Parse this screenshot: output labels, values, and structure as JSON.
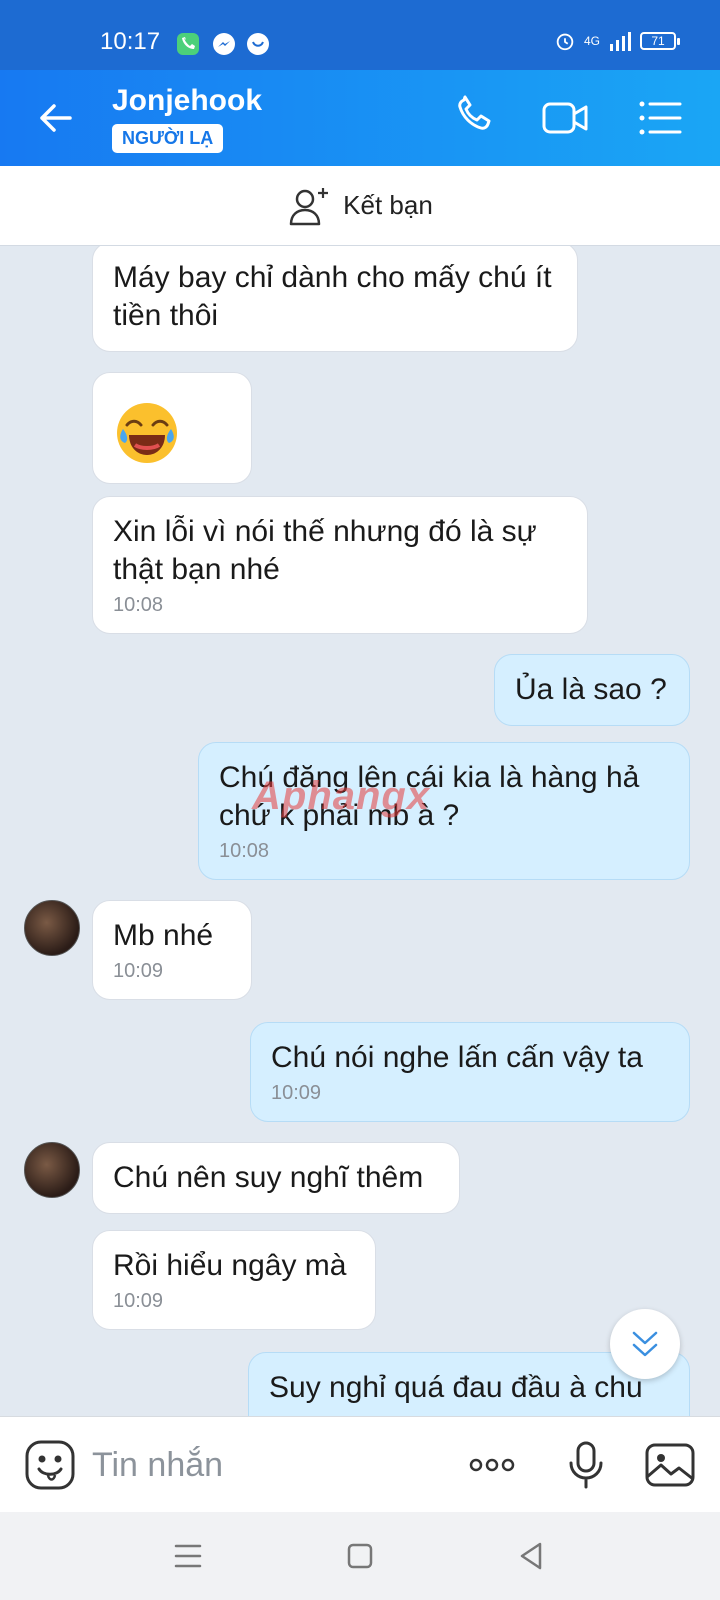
{
  "status_bar": {
    "time": "10:17",
    "network": "4G",
    "battery": "71",
    "left_icons": [
      "phone-icon",
      "messenger-icon",
      "heart-app-icon"
    ],
    "right_icons": [
      "alarm-icon",
      "signal-icon",
      "battery-icon"
    ]
  },
  "header": {
    "contact_name": "Jonjehook",
    "badge": "NGƯỜI LẠ",
    "icons": [
      "back-arrow-icon",
      "phone-call-icon",
      "video-call-icon",
      "menu-list-icon"
    ]
  },
  "add_friend": {
    "label": "Kết bạn",
    "icon": "add-person-icon"
  },
  "messages": [
    {
      "dir": "in",
      "text": "Máy bay chỉ dành cho mấy chú ít tiền thôi"
    },
    {
      "dir": "in",
      "emoji": "tears-of-joy-icon"
    },
    {
      "dir": "in",
      "text": "Xin lỗi vì nói thế nhưng đó là sự thật bạn nhé",
      "time": "10:08"
    },
    {
      "dir": "out",
      "text": "Ủa là sao ?"
    },
    {
      "dir": "out",
      "text": "Chú đăng lên cái kia là hàng hả chứ k phải mb à ?",
      "time": "10:08"
    },
    {
      "dir": "in",
      "text": "Mb nhé",
      "time": "10:09",
      "avatar": true
    },
    {
      "dir": "out",
      "text": "Chú nói nghe lấn cấn vậy ta",
      "time": "10:09"
    },
    {
      "dir": "in",
      "text": "Chú nên suy nghĩ thêm",
      "avatar": true
    },
    {
      "dir": "in",
      "text": "Rồi hiểu ngây mà",
      "time": "10:09"
    },
    {
      "dir": "out",
      "text": "Suy nghỉ quá đau đầu à chu"
    }
  ],
  "watermark": "Aphangx",
  "composer": {
    "placeholder": "Tin nhắn",
    "icons": [
      "sticker-icon",
      "more-dots-icon",
      "microphone-icon",
      "image-icon"
    ]
  },
  "nav": {
    "icons": [
      "recents-icon",
      "home-icon",
      "back-icon"
    ]
  },
  "colors": {
    "header_start": "#1779f2",
    "header_end": "#1aa6f5",
    "status_bar": "#1d6bd2",
    "out_bubble": "#d5efff",
    "background": "#e2e9f1"
  }
}
